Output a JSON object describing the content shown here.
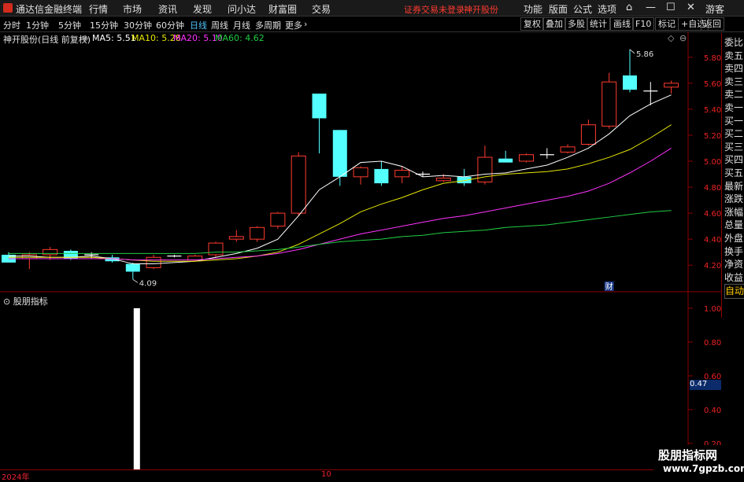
{
  "app": {
    "title": "通达信金融终端",
    "menu": [
      "行情",
      "市场",
      "资讯",
      "发现",
      "问小达",
      "财富圈",
      "交易"
    ],
    "notice": "证券交易未登录",
    "stock_link": "神开股份",
    "right_menu": [
      "功能",
      "版面",
      "公式",
      "选项"
    ],
    "user": "游客"
  },
  "toolbar": {
    "periods": [
      "分时",
      "1分钟",
      "5分钟",
      "15分钟",
      "30分钟",
      "60分钟",
      "日线",
      "周线",
      "月线",
      "多周期",
      "更多"
    ],
    "active_period": "日线",
    "buttons": [
      "复权",
      "叠加",
      "多股",
      "统计",
      "画线",
      "F10",
      "标记",
      "+自选",
      "返回"
    ]
  },
  "chart_info": {
    "name": "神开股份(日线 前复权)",
    "ma5_label": "MA5: 5.51",
    "ma10_label": "MA10: 5.28",
    "ma20_label": "MA20: 5.10",
    "ma60_label": "MA60: 4.62",
    "ma5_color": "#ffffff",
    "ma10_color": "#e6e600",
    "ma20_color": "#ff33ff",
    "ma60_color": "#22cc44"
  },
  "right_panel": [
    "委比",
    "卖五",
    "卖四",
    "卖三",
    "卖二",
    "卖一",
    "买一",
    "买二",
    "买三",
    "买四",
    "买五",
    "最新",
    "涨跌",
    "涨幅",
    "总量",
    "外盘",
    "换手",
    "净资",
    "收益",
    "自动"
  ],
  "chart_data": {
    "type": "candlestick",
    "y_ticks": [
      "5.80",
      "5.60",
      "5.40",
      "5.20",
      "5.00",
      "4.80",
      "4.60",
      "4.40",
      "4.20"
    ],
    "ylim": [
      4.05,
      5.95
    ],
    "high_annotation": "5.86",
    "low_annotation": "4.09",
    "event_marker": "财",
    "up_color": "#ff3b30",
    "down_color": "#54ffff",
    "candles": [
      {
        "o": 4.28,
        "h": 4.3,
        "l": 4.22,
        "c": 4.22
      },
      {
        "o": 4.25,
        "h": 4.3,
        "l": 4.17,
        "c": 4.28
      },
      {
        "o": 4.28,
        "h": 4.34,
        "l": 4.24,
        "c": 4.32
      },
      {
        "o": 4.31,
        "h": 4.32,
        "l": 4.24,
        "c": 4.25
      },
      {
        "o": 4.27,
        "h": 4.3,
        "l": 4.25,
        "c": 4.28
      },
      {
        "o": 4.26,
        "h": 4.28,
        "l": 4.22,
        "c": 4.23
      },
      {
        "o": 4.21,
        "h": 4.22,
        "l": 4.09,
        "c": 4.15
      },
      {
        "o": 4.18,
        "h": 4.28,
        "l": 4.17,
        "c": 4.26
      },
      {
        "o": 4.27,
        "h": 4.28,
        "l": 4.26,
        "c": 4.27
      },
      {
        "o": 4.24,
        "h": 4.28,
        "l": 4.23,
        "c": 4.27
      },
      {
        "o": 4.28,
        "h": 4.38,
        "l": 4.26,
        "c": 4.37
      },
      {
        "o": 4.4,
        "h": 4.47,
        "l": 4.38,
        "c": 4.42
      },
      {
        "o": 4.4,
        "h": 4.5,
        "l": 4.38,
        "c": 4.49
      },
      {
        "o": 4.5,
        "h": 4.61,
        "l": 4.48,
        "c": 4.6
      },
      {
        "o": 4.6,
        "h": 5.07,
        "l": 4.58,
        "c": 5.04
      },
      {
        "o": 5.52,
        "h": 5.52,
        "l": 5.06,
        "c": 5.33
      },
      {
        "o": 5.24,
        "h": 5.24,
        "l": 4.81,
        "c": 4.88
      },
      {
        "o": 4.88,
        "h": 4.96,
        "l": 4.82,
        "c": 4.95
      },
      {
        "o": 4.94,
        "h": 5.0,
        "l": 4.81,
        "c": 4.83
      },
      {
        "o": 4.88,
        "h": 4.96,
        "l": 4.83,
        "c": 4.93
      },
      {
        "o": 4.9,
        "h": 4.92,
        "l": 4.88,
        "c": 4.89
      },
      {
        "o": 4.85,
        "h": 4.9,
        "l": 4.84,
        "c": 4.87
      },
      {
        "o": 4.88,
        "h": 4.94,
        "l": 4.81,
        "c": 4.83
      },
      {
        "o": 4.84,
        "h": 5.12,
        "l": 4.82,
        "c": 5.03
      },
      {
        "o": 5.02,
        "h": 5.08,
        "l": 4.99,
        "c": 4.99
      },
      {
        "o": 5.0,
        "h": 5.06,
        "l": 4.99,
        "c": 5.05
      },
      {
        "o": 5.05,
        "h": 5.1,
        "l": 5.02,
        "c": 5.05
      },
      {
        "o": 5.07,
        "h": 5.13,
        "l": 5.06,
        "c": 5.11
      },
      {
        "o": 5.13,
        "h": 5.32,
        "l": 5.12,
        "c": 5.28
      },
      {
        "o": 5.27,
        "h": 5.68,
        "l": 5.25,
        "c": 5.61
      },
      {
        "o": 5.66,
        "h": 5.86,
        "l": 5.53,
        "c": 5.55
      },
      {
        "o": 5.54,
        "h": 5.61,
        "l": 5.43,
        "c": 5.54
      },
      {
        "o": 5.57,
        "h": 5.62,
        "l": 5.52,
        "c": 5.6
      }
    ],
    "ma5": [
      4.27,
      4.27,
      4.26,
      4.26,
      4.27,
      4.25,
      4.21,
      4.21,
      4.22,
      4.23,
      4.26,
      4.29,
      4.33,
      4.4,
      4.58,
      4.78,
      4.88,
      4.99,
      5.0,
      4.96,
      4.88,
      4.89,
      4.88,
      4.9,
      4.91,
      4.94,
      4.97,
      5.03,
      5.1,
      5.21,
      5.35,
      5.44,
      5.51
    ],
    "ma10": [
      4.26,
      4.26,
      4.26,
      4.26,
      4.26,
      4.25,
      4.24,
      4.23,
      4.23,
      4.23,
      4.24,
      4.25,
      4.27,
      4.3,
      4.36,
      4.44,
      4.52,
      4.61,
      4.67,
      4.72,
      4.78,
      4.83,
      4.85,
      4.88,
      4.9,
      4.91,
      4.92,
      4.94,
      4.98,
      5.03,
      5.09,
      5.18,
      5.28
    ],
    "ma20": [
      4.25,
      4.25,
      4.25,
      4.25,
      4.25,
      4.25,
      4.24,
      4.24,
      4.24,
      4.24,
      4.25,
      4.26,
      4.27,
      4.29,
      4.32,
      4.36,
      4.4,
      4.44,
      4.47,
      4.5,
      4.53,
      4.56,
      4.58,
      4.61,
      4.64,
      4.67,
      4.7,
      4.73,
      4.77,
      4.83,
      4.91,
      5.0,
      5.1
    ],
    "ma60": [
      4.29,
      4.29,
      4.29,
      4.29,
      4.29,
      4.29,
      4.29,
      4.29,
      4.29,
      4.29,
      4.3,
      4.3,
      4.31,
      4.32,
      4.34,
      4.36,
      4.38,
      4.39,
      4.4,
      4.42,
      4.43,
      4.45,
      4.46,
      4.47,
      4.49,
      4.5,
      4.51,
      4.53,
      4.55,
      4.57,
      4.59,
      4.61,
      4.62
    ]
  },
  "indicator": {
    "title": "股朋指标",
    "y_ticks": [
      "1.00",
      "0.80",
      "0.60",
      "0.40",
      "0.20"
    ],
    "current_value": "0.47",
    "bar_value": 1.0,
    "bar_index": 6
  },
  "x_axis": {
    "labels": [
      "2024年",
      "10"
    ]
  },
  "watermark": {
    "line1": "股朋指标网",
    "line2": "www.7gpzb.com"
  }
}
